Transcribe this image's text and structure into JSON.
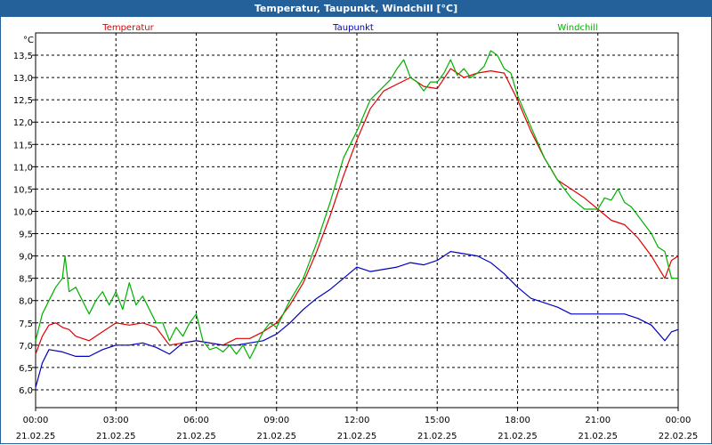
{
  "window": {
    "title": "Temperatur, Taupunkt, Windchill [°C]"
  },
  "chart_data": {
    "type": "line",
    "title": "Temperatur, Taupunkt, Windchill [°C]",
    "unit_label": "°C",
    "xlabel": "",
    "ylabel": "",
    "grid": true,
    "legend_placement": "top",
    "x_range_hours": [
      0,
      24
    ],
    "ylim": [
      5.6,
      14.0
    ],
    "y_ticks": [
      "6,0",
      "6,5",
      "7,0",
      "7,5",
      "8,0",
      "8,5",
      "9,0",
      "9,5",
      "10,0",
      "10,5",
      "11,0",
      "11,5",
      "12,0",
      "12,5",
      "13,0",
      "13,5"
    ],
    "x_ticks": [
      {
        "time": "00:00",
        "date": "21.02.25"
      },
      {
        "time": "03:00",
        "date": "21.02.25"
      },
      {
        "time": "06:00",
        "date": "21.02.25"
      },
      {
        "time": "09:00",
        "date": "21.02.25"
      },
      {
        "time": "12:00",
        "date": "21.02.25"
      },
      {
        "time": "15:00",
        "date": "21.02.25"
      },
      {
        "time": "18:00",
        "date": "21.02.25"
      },
      {
        "time": "21:00",
        "date": "21.02.25"
      },
      {
        "time": "00:00",
        "date": "22.02.25"
      }
    ],
    "series": [
      {
        "name": "Temperatur",
        "color": "#e00000",
        "x": [
          0,
          0.25,
          0.5,
          0.75,
          1,
          1.25,
          1.5,
          2,
          2.5,
          3,
          3.5,
          4,
          4.5,
          5,
          5.5,
          6,
          6.5,
          7,
          7.5,
          8,
          8.5,
          9,
          9.5,
          10,
          10.5,
          11,
          11.5,
          12,
          12.5,
          13,
          13.5,
          14,
          14.5,
          15,
          15.5,
          16,
          16.5,
          17,
          17.5,
          18,
          18.5,
          19,
          19.5,
          20,
          20.5,
          21,
          21.5,
          22,
          22.5,
          23,
          23.5,
          23.75,
          24
        ],
        "y": [
          6.8,
          7.2,
          7.45,
          7.5,
          7.4,
          7.35,
          7.2,
          7.1,
          7.3,
          7.5,
          7.45,
          7.5,
          7.4,
          7.0,
          7.05,
          7.1,
          7.05,
          7.0,
          7.15,
          7.15,
          7.3,
          7.5,
          7.9,
          8.4,
          9.1,
          9.9,
          10.8,
          11.6,
          12.3,
          12.7,
          12.85,
          13.0,
          12.8,
          12.75,
          13.2,
          13.0,
          13.1,
          13.15,
          13.1,
          12.5,
          11.8,
          11.2,
          10.7,
          10.5,
          10.3,
          10.05,
          9.8,
          9.7,
          9.4,
          9.0,
          8.5,
          8.9,
          9.0
        ]
      },
      {
        "name": "Taupunkt",
        "color": "#0000c0",
        "x": [
          0,
          0.25,
          0.5,
          1,
          1.5,
          2,
          2.5,
          3,
          3.5,
          4,
          4.5,
          5,
          5.5,
          6,
          6.5,
          7,
          7.5,
          8,
          8.5,
          9,
          9.5,
          10,
          10.5,
          11,
          11.5,
          12,
          12.5,
          13,
          13.5,
          14,
          14.5,
          15,
          15.5,
          16,
          16.5,
          17,
          17.5,
          18,
          18.5,
          19,
          19.5,
          20,
          20.5,
          21,
          21.5,
          22,
          22.5,
          23,
          23.5,
          23.75,
          24
        ],
        "y": [
          6.05,
          6.6,
          6.9,
          6.85,
          6.75,
          6.75,
          6.9,
          7.0,
          7.0,
          7.05,
          6.95,
          6.8,
          7.05,
          7.1,
          7.05,
          7.0,
          7.0,
          7.05,
          7.1,
          7.25,
          7.5,
          7.8,
          8.05,
          8.25,
          8.5,
          8.75,
          8.65,
          8.7,
          8.75,
          8.85,
          8.8,
          8.9,
          9.1,
          9.05,
          9.0,
          8.85,
          8.6,
          8.3,
          8.05,
          7.95,
          7.85,
          7.7,
          7.7,
          7.7,
          7.7,
          7.7,
          7.6,
          7.45,
          7.1,
          7.3,
          7.35
        ]
      },
      {
        "name": "Windchill",
        "color": "#00b000",
        "x": [
          0,
          0.25,
          0.5,
          0.75,
          1,
          1.1,
          1.25,
          1.5,
          1.75,
          2,
          2.25,
          2.5,
          2.75,
          3,
          3.25,
          3.5,
          3.75,
          4,
          4.25,
          4.5,
          4.75,
          5,
          5.25,
          5.5,
          5.75,
          6,
          6.25,
          6.5,
          6.75,
          7,
          7.25,
          7.5,
          7.75,
          8,
          8.25,
          8.5,
          8.75,
          9,
          9.5,
          10,
          10.5,
          11,
          11.5,
          12,
          12.5,
          13,
          13.25,
          13.5,
          13.75,
          14,
          14.25,
          14.5,
          14.75,
          15,
          15.25,
          15.5,
          15.75,
          16,
          16.25,
          16.5,
          16.75,
          17,
          17.25,
          17.5,
          17.75,
          18,
          18.5,
          19,
          19.5,
          20,
          20.5,
          21,
          21.25,
          21.5,
          21.75,
          22,
          22.25,
          22.5,
          22.75,
          23,
          23.25,
          23.5,
          23.75,
          24
        ],
        "y": [
          7.1,
          7.7,
          8.0,
          8.3,
          8.5,
          9.0,
          8.2,
          8.3,
          8.0,
          7.7,
          8.0,
          8.2,
          7.9,
          8.2,
          7.8,
          8.4,
          7.9,
          8.1,
          7.8,
          7.5,
          7.5,
          7.1,
          7.4,
          7.2,
          7.5,
          7.7,
          7.1,
          6.9,
          6.95,
          6.85,
          7.0,
          6.8,
          7.0,
          6.7,
          7.0,
          7.3,
          7.5,
          7.4,
          8.0,
          8.5,
          9.3,
          10.2,
          11.2,
          11.8,
          12.5,
          12.8,
          12.95,
          13.2,
          13.4,
          13.0,
          12.9,
          12.7,
          12.9,
          12.9,
          13.1,
          13.4,
          13.05,
          13.2,
          13.0,
          13.1,
          13.25,
          13.6,
          13.5,
          13.2,
          13.1,
          12.6,
          11.9,
          11.2,
          10.7,
          10.3,
          10.05,
          10.05,
          10.3,
          10.25,
          10.5,
          10.2,
          10.1,
          9.9,
          9.7,
          9.5,
          9.2,
          9.1,
          8.5,
          8.5
        ]
      }
    ]
  }
}
